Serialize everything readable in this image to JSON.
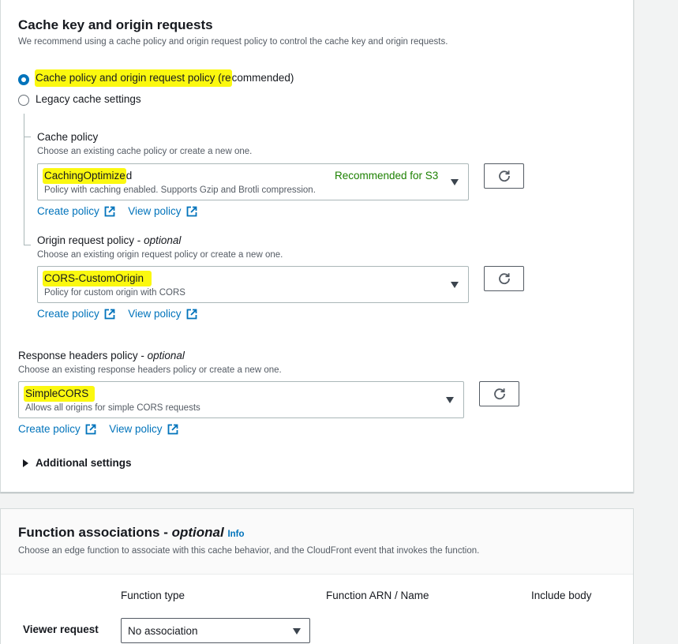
{
  "cache_section": {
    "title": "Cache key and origin requests",
    "description": "We recommend using a cache policy and origin request policy to control the cache key and origin requests.",
    "radio_options": [
      {
        "label_highlighted": "Cache policy and origin request policy (re",
        "label_rest": "commended)",
        "selected": true
      },
      {
        "label": "Legacy cache settings",
        "selected": false
      }
    ]
  },
  "cache_policy": {
    "label": "Cache policy",
    "description": "Choose an existing cache policy or create a new one.",
    "selected_highlighted": "CachingOptimize",
    "selected_rest": "d",
    "badge": "Recommended for S3",
    "sub": "Policy with caching enabled. Supports Gzip and Brotli compression.",
    "create_link": "Create policy",
    "view_link": "View policy"
  },
  "origin_request_policy": {
    "label": "Origin request policy - ",
    "label_optional": "optional",
    "description": "Choose an existing origin request policy or create a new one.",
    "selected": "CORS-CustomOrigin",
    "sub": "Policy for custom origin with CORS",
    "create_link": "Create policy",
    "view_link": "View policy"
  },
  "response_headers_policy": {
    "label": "Response headers policy - ",
    "label_optional": "optional",
    "description": "Choose an existing response headers policy or create a new one.",
    "selected": "SimpleCORS",
    "sub": "Allows all origins for simple CORS requests",
    "create_link": "Create policy",
    "view_link": "View policy"
  },
  "additional_settings": "Additional settings",
  "function_associations": {
    "title": "Function associations - ",
    "title_optional": "optional",
    "info": "Info",
    "description": "Choose an edge function to associate with this cache behavior, and the CloudFront event that invokes the function.",
    "columns": [
      "Function type",
      "Function ARN / Name",
      "Include body"
    ],
    "rows": [
      {
        "label": "Viewer request",
        "value": "No association"
      }
    ]
  },
  "colors": {
    "link": "#0073bb",
    "highlight": "#fbf80f",
    "recommended": "#1d8102",
    "radio_selected": "#0073bb"
  }
}
